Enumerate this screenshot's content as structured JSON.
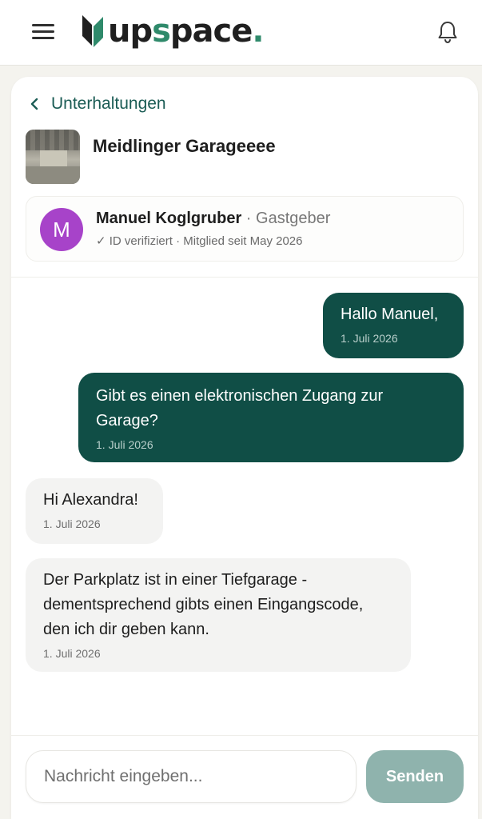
{
  "header": {
    "brand": {
      "pre": "up",
      "s": "s",
      "post": "pace",
      "dot": "."
    },
    "menu_icon": "hamburger-menu-icon",
    "notification_icon": "bell-icon",
    "brand_color": "#2f8a6b"
  },
  "conversation": {
    "back_label": "Unterhaltungen",
    "listing_title": "Meidlinger Garageeee",
    "host": {
      "initial": "M",
      "name": "Manuel Koglgruber",
      "role_sep": " · ",
      "role": "Gastgeber",
      "meta": "✓ ID verifiziert · Mitglied seit May 2026",
      "avatar_color": "#a743c9"
    }
  },
  "messages": [
    {
      "direction": "out",
      "text": "Hallo Manuel,",
      "time": "1. Juli 2026"
    },
    {
      "direction": "out",
      "text": "Gibt es einen elektronischen Zugang zur Garage?",
      "time": "1. Juli 2026"
    },
    {
      "direction": "in",
      "text": "Hi Alexandra!",
      "time": "1. Juli 2026"
    },
    {
      "direction": "in",
      "text": "Der Parkplatz ist in einer Tiefgarage - dementsprechend gibts einen Eingangscode, den ich dir geben kann.",
      "time": "1. Juli 2026"
    }
  ],
  "composer": {
    "placeholder": "Nachricht eingeben...",
    "value": "",
    "send_label": "Senden"
  },
  "colors": {
    "outgoing_bubble": "#104e46",
    "incoming_bubble": "#f3f3f2",
    "send_button": "#8fb3ad",
    "accent_text": "#1b5c55"
  }
}
